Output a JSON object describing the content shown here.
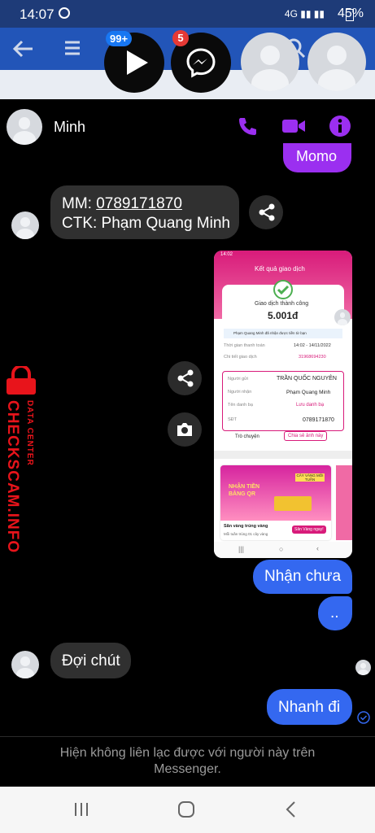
{
  "status": {
    "time": "14:07",
    "battery": "45%"
  },
  "chat_heads": {
    "badge1": "99+",
    "badge2": "5"
  },
  "contact": {
    "name": "Minh"
  },
  "messages": {
    "momo": "Momo",
    "mm_prefix": "MM: ",
    "mm_number": "0789171870",
    "ctk": "CTK: Phạm Quang Minh",
    "nhan_chua": "Nhận chưa",
    "dots": "..",
    "doi_chut": "Đợi chút",
    "nhanh_di": "Nhanh đi"
  },
  "receipt": {
    "statusbar": "14:02",
    "title": "Kết quả giao dịch",
    "success": "Giao dịch thành công",
    "amount": "5.001đ",
    "notice": "Phạm Quang Minh đã nhận được tiền từ bạn",
    "time_label": "Thời gian thanh toán",
    "time_value": "14:02 - 14/11/2022",
    "detail_label": "Chi tiết giao dịch",
    "detail_value": "31968694230",
    "sender_label": "Người gửi",
    "sender_value": "TRẦN QUỐC NGUYÊN",
    "receiver_label": "Người nhận",
    "receiver_value": "Phạm Quang Minh",
    "contact_label": "Tên danh bạ",
    "contact_value": "Lưu danh bạ",
    "phone_label": "SĐT",
    "phone_value": "0789171870",
    "chat_btn": "Trò chuyện",
    "share_btn": "Chia sẻ ảnh này",
    "promo_title": "NHẬN TIỀN BẰNG QR",
    "promo_caption": "Săn vàng trúng vàng",
    "promo_sub": "Mỗi tuần trúng 01 cây vàng",
    "promo_btn": "Săn Vàng ngay!",
    "promo_tag": "CÂY VÀNG MỖI TUẦN"
  },
  "watermark": {
    "small": "DATA CENTER",
    "big": "CHECKSCAM.INFO"
  },
  "footer": {
    "text": "Hiện không liên lạc được với người này trên Messenger."
  },
  "colors": {
    "accent": "#9b2ff0",
    "outgoing": "#3468f0",
    "watermark": "#e8141b"
  }
}
